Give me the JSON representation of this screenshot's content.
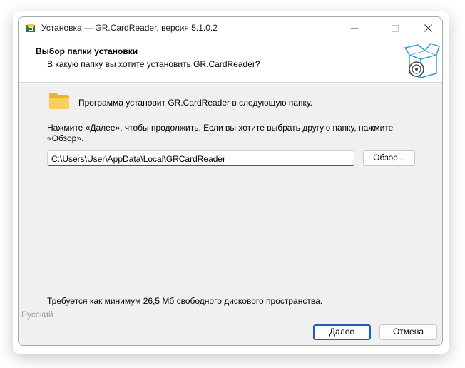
{
  "window": {
    "title": "Установка — GR.CardReader, версия 5.1.0.2",
    "accent_color": "#1a5fb4"
  },
  "caption_buttons": {
    "minimize_icon": "minimize-icon",
    "maximize_icon": "maximize-icon",
    "close_icon": "close-icon"
  },
  "header": {
    "title": "Выбор папки установки",
    "subtitle": "В какую папку вы хотите установить GR.CardReader?",
    "art_icon": "installer-box-cd-icon"
  },
  "main": {
    "folder_icon": "folder-icon",
    "intro": "Программа установит GR.CardReader в следующую папку.",
    "instruction": "Нажмите «Далее», чтобы продолжить. Если вы хотите выбрать другую папку, нажмите «Обзор».",
    "path_value": "C:\\Users\\User\\AppData\\Local\\GRCardReader",
    "browse_label": "Обзор...",
    "space_required": "Требуется как минимум 26,5 Мб свободного дискового пространства."
  },
  "footer": {
    "language": "Русский",
    "next_label": "Далее",
    "cancel_label": "Отмена"
  }
}
